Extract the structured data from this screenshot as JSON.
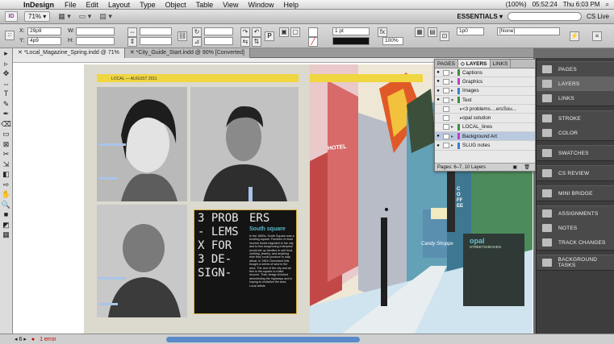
{
  "menubar": {
    "app": "InDesign",
    "items": [
      "File",
      "Edit",
      "Layout",
      "Type",
      "Object",
      "Table",
      "View",
      "Window",
      "Help"
    ],
    "battery": "(100%)",
    "time": "05:52:24",
    "clock": "Thu 6:03 PM"
  },
  "appbar": {
    "logo": "ID",
    "zoom": "71%",
    "workspace": "ESSENTIALS ▾",
    "search_placeholder": "",
    "cs_live": "CS Live"
  },
  "control": {
    "x_label": "X:",
    "x_value": "29p9",
    "y_label": "Y:",
    "y_value": "4p9",
    "w_label": "W:",
    "h_label": "H:",
    "stroke_weight": "1 pt",
    "percent": "100%",
    "gap": "1p0",
    "style": "[None]"
  },
  "tabs": [
    {
      "label": "*Local_Magazine_Spring.indd @ 71%"
    },
    {
      "label": "*City_Guide_Start.indd @ 90% [Converted]"
    }
  ],
  "tools": [
    "▸",
    "▹",
    "✥",
    "⇔",
    "T",
    "✎",
    "✒",
    "⌫",
    "▭",
    "⊠",
    "✂",
    "⇲",
    "◧",
    "⇨",
    "✋",
    "🔍",
    "■",
    "◩",
    "▦"
  ],
  "page": {
    "header": "LOCAL — AUGUST 2011",
    "headline": "3 PROB- LEMS X FOR 3 DE- SIGN-",
    "headline_right": "ERS",
    "subhead": "South square",
    "body": "In the 1880s, South Square was a bustling square. Families of most income levels migrated to the city and to this burgeoning enterprise would set up families to sell food, clothing, jewelry, and anything else they could produce to stay afloat. In 1963 Cheveland hills bought a series of land in the area. The rest of the city and all feel in the square to make recover. Their design finished demolishing the highways and is hoping to revitalize the area. Local artists",
    "sign_opal": "opal",
    "sign_streets": "STREETSHEAVEN",
    "sign_candy": "Candy Shoppe",
    "sign_hotel": "HOTEL",
    "sign_coffee": "COFFEE"
  },
  "layers_panel": {
    "tabs": [
      "PAGES",
      "◇ LAYERS",
      "LINKS"
    ],
    "layers": [
      {
        "name": "Captions",
        "color": "#3a8f3a"
      },
      {
        "name": "Graphics",
        "color": "#c040c0"
      },
      {
        "name": "Images",
        "color": "#3a7fd0"
      },
      {
        "name": "Text",
        "color": "#3a8f3a"
      },
      {
        "name": "<3 problems....ersSou...",
        "color": "#3a8f3a"
      },
      {
        "name": "opal solution",
        "color": "#3a8f3a"
      },
      {
        "name": "LOCAL_lines",
        "color": "#3a8f3a"
      },
      {
        "name": "Background Art",
        "color": "#c040c0"
      },
      {
        "name": "SLUG notes",
        "color": "#3a7fd0"
      }
    ],
    "footer": "Pages: 6–7, 10 Layers"
  },
  "dock": {
    "groups": [
      [
        "PAGES",
        "LAYERS",
        "LINKS"
      ],
      [
        "STROKE",
        "COLOR"
      ],
      [
        "SWATCHES"
      ],
      [
        "CS REVIEW"
      ],
      [
        "MINI BRIDGE"
      ],
      [
        "ASSIGNMENTS",
        "NOTES",
        "TRACK CHANGES"
      ],
      [
        "BACKGROUND TASKS"
      ]
    ]
  },
  "status": {
    "page": "6",
    "errors": "1 error"
  }
}
